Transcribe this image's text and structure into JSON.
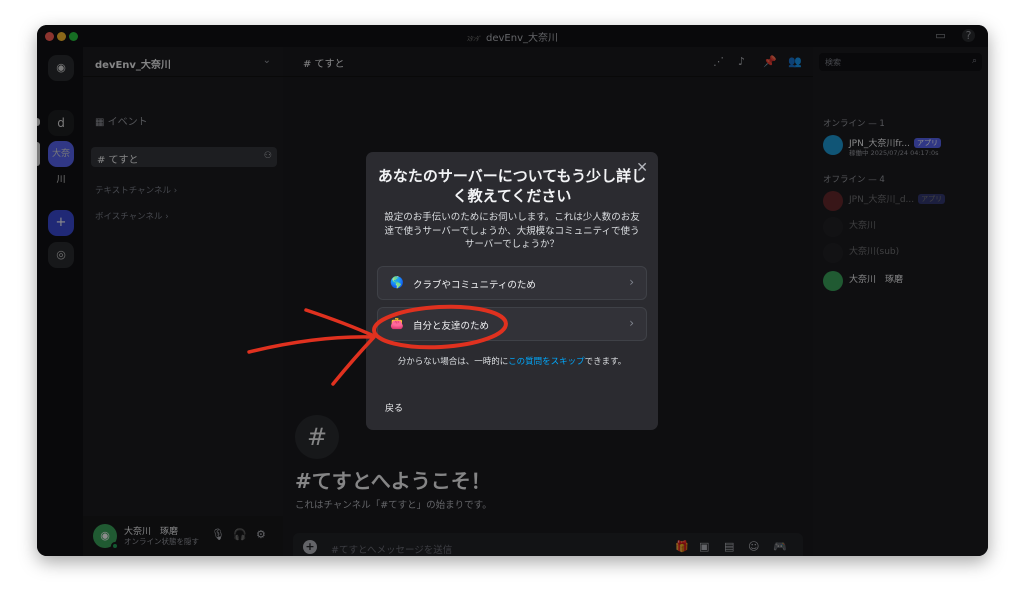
{
  "window": {
    "title": "devEnv_大奈川",
    "title_prefix": "ｽﾀﾝﾀﾞ"
  },
  "servers": {
    "items": [
      {
        "label": "d"
      },
      {
        "label": "大奈川"
      }
    ],
    "add": "+"
  },
  "sidebar": {
    "guild_name": "devEnv_大奈川",
    "event_label": "イベント",
    "active_channel": "# てすと",
    "categories": [
      "テキストチャンネル ›",
      "ボイスチャンネル ›"
    ]
  },
  "user": {
    "name": "大奈川　琢磨",
    "status": "オンライン状態を隠す"
  },
  "header": {
    "channel": "# てすと"
  },
  "welcome": {
    "icon": "#",
    "title": "#てすとへようこそ！",
    "desc": "これはチャンネル「#てすと」の始まりです。"
  },
  "message": {
    "placeholder": "#てすとへメッセージを送信"
  },
  "members": {
    "search_placeholder": "検索",
    "online_header": "オンライン — 1",
    "offline_header": "オフライン — 4",
    "list": [
      {
        "name": "JPN_大奈川fr...",
        "sub": "稼働中 2025/07/24 04:17:0s",
        "badge": "アプリ"
      },
      {
        "name": "JPN_大奈川_d...",
        "badge": "アプリ"
      },
      {
        "name": "大奈川"
      },
      {
        "name": "大奈川(sub)"
      },
      {
        "name": "大奈川　琢磨"
      }
    ]
  },
  "modal": {
    "title": "あなたのサーバーについてもう少し詳しく教えてください",
    "desc": "設定のお手伝いのためにお伺いします。これは少人数のお友達で使うサーバーでしょうか、大規模なコミュニティで使うサーバーでしょうか？",
    "options": [
      {
        "label": "クラブやコミュニティのため",
        "icon": "🌎"
      },
      {
        "label": "自分と友達のため",
        "icon": "👛"
      }
    ],
    "skip_prefix": "分からない場合は、一時的に",
    "skip_link": "この質問をスキップ",
    "skip_suffix": "できます。",
    "back": "戻る"
  },
  "colors": {
    "accent": "#5865f2",
    "link": "#00a8fc",
    "annotation": "#e0311f",
    "online": "#23a55a"
  }
}
